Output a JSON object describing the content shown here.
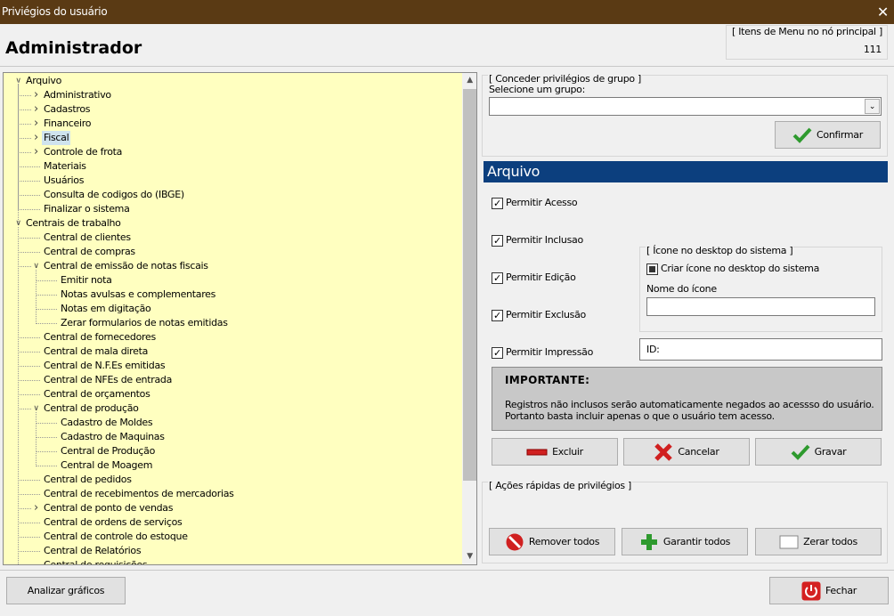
{
  "window": {
    "title": "Priviégios do usuário",
    "close_glyph": "✕"
  },
  "header": {
    "user_name": "Administrador",
    "menu_items_label": "[ Itens de Menu no nó principal ]",
    "menu_items_count": "111"
  },
  "tree": {
    "items": [
      {
        "label": "Arquivo",
        "level": 0,
        "expander": "open"
      },
      {
        "label": "Administrativo",
        "level": 1,
        "expander": "closed"
      },
      {
        "label": "Cadastros",
        "level": 1,
        "expander": "closed"
      },
      {
        "label": "Financeiro",
        "level": 1,
        "expander": "closed"
      },
      {
        "label": "Fiscal",
        "level": 1,
        "expander": "closed",
        "selected": true
      },
      {
        "label": "Controle de frota",
        "level": 1,
        "expander": "closed"
      },
      {
        "label": "Materiais",
        "level": 1
      },
      {
        "label": "Usuários",
        "level": 1
      },
      {
        "label": "Consulta de codigos do (IBGE)",
        "level": 1
      },
      {
        "label": "Finalizar o sistema",
        "level": 1
      },
      {
        "label": "Centrais de trabalho",
        "level": 0,
        "expander": "open"
      },
      {
        "label": "Central de clientes",
        "level": 1
      },
      {
        "label": "Central de compras",
        "level": 1
      },
      {
        "label": "Central de emissão de notas fiscais",
        "level": 1,
        "expander": "open"
      },
      {
        "label": "Emitir nota",
        "level": 2
      },
      {
        "label": "Notas avulsas e complementares",
        "level": 2
      },
      {
        "label": "Notas em digitação",
        "level": 2
      },
      {
        "label": "Zerar formularios de notas emitidas",
        "level": 2
      },
      {
        "label": "Central de fornecedores",
        "level": 1
      },
      {
        "label": "Central de mala direta",
        "level": 1
      },
      {
        "label": "Central de N.F.Es emitidas",
        "level": 1
      },
      {
        "label": "Central de NFEs de entrada",
        "level": 1
      },
      {
        "label": "Central de orçamentos",
        "level": 1
      },
      {
        "label": "Central de produção",
        "level": 1,
        "expander": "open"
      },
      {
        "label": "Cadastro de Moldes",
        "level": 2
      },
      {
        "label": "Cadastro de Maquinas",
        "level": 2
      },
      {
        "label": "Central de Produção",
        "level": 2
      },
      {
        "label": "Central de Moagem",
        "level": 2
      },
      {
        "label": "Central de pedidos",
        "level": 1
      },
      {
        "label": "Central de recebimentos de mercadorias",
        "level": 1
      },
      {
        "label": "Central de ponto de vendas",
        "level": 1,
        "expander": "closed"
      },
      {
        "label": "Central de ordens de serviços",
        "level": 1
      },
      {
        "label": "Central de controle do estoque",
        "level": 1
      },
      {
        "label": "Central de Relatórios",
        "level": 1
      },
      {
        "label": "Central de requisições",
        "level": 1
      }
    ]
  },
  "group": {
    "caption": "[ Conceder privilégios de grupo ]",
    "select_label": "Selecione um grupo:",
    "selected_value": "",
    "confirm_label": "Confirmar"
  },
  "node": {
    "title": "Arquivo"
  },
  "permissions": [
    {
      "label": "Permitir Acesso",
      "checked": true
    },
    {
      "label": "Permitir Inclusao",
      "checked": true
    },
    {
      "label": "Permitir Edição",
      "checked": true
    },
    {
      "label": "Permitir Exclusão",
      "checked": true
    },
    {
      "label": "Permitir Impressão",
      "checked": true
    }
  ],
  "desktop_icon": {
    "caption": "[ Ícone no desktop do sistema ]",
    "create_label": "Criar ícone no desktop do sistema",
    "create_state": "indeterminate",
    "name_label": "Nome do ícone",
    "name_value": "",
    "id_value": "ID:"
  },
  "important": {
    "title": "IMPORTANTE:",
    "line1": "Registros não inclusos serão automaticamente negados ao acessso do usuário.",
    "line2": "Portanto basta incluir apenas o que o usuário tem acesso."
  },
  "actions": {
    "delete_label": "Excluir",
    "cancel_label": "Cancelar",
    "save_label": "Gravar"
  },
  "quick": {
    "caption": "[ Ações rápidas de privilégios ]",
    "remove_all": "Remover todos",
    "grant_all": "Garantir todos",
    "clear_all": "Zerar todos"
  },
  "footer": {
    "charts_label": "Analizar gráficos",
    "close_label": "Fechar"
  },
  "colors": {
    "title_bar": "#5a3a14",
    "tree_bg": "#ffffc0",
    "node_header": "#0c3f7e",
    "important_bg": "#c8c8c8"
  }
}
